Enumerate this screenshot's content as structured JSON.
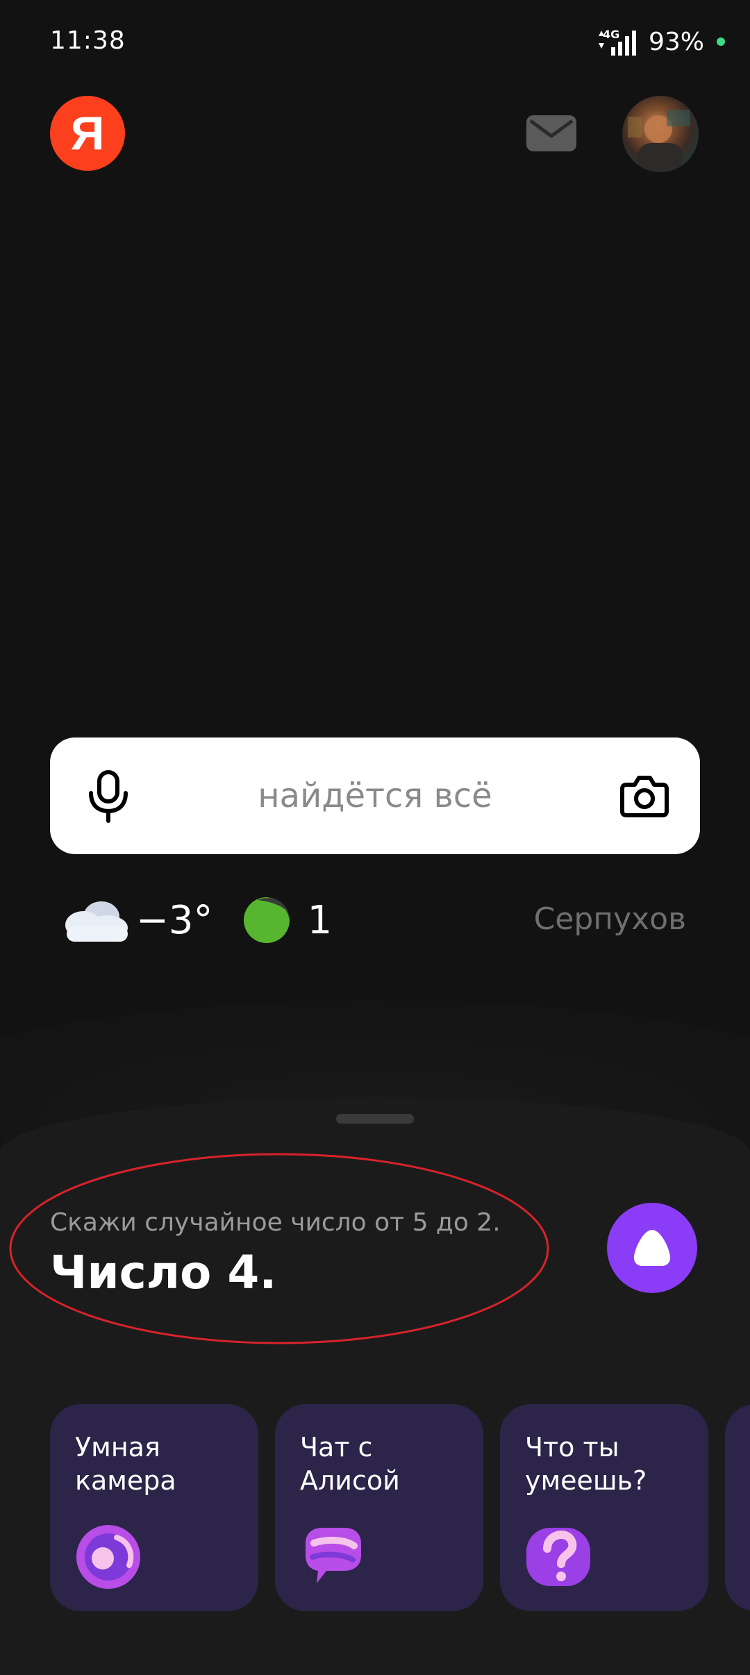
{
  "status_bar": {
    "time": "11:38",
    "network": "4G",
    "battery": "93%",
    "dot_color": "#3ddc84"
  },
  "header": {
    "logo_text": "Я",
    "logo_color": "#fc3f1d",
    "mail_icon": "mail-icon",
    "avatar": "user-avatar"
  },
  "search": {
    "placeholder": "найдётся всё",
    "left_icon": "microphone-icon",
    "right_icon": "camera-icon"
  },
  "widgets": {
    "weather_icon": "cloud-icon",
    "temperature": "−3°",
    "traffic_icon": "traffic-icon",
    "traffic_score": "1",
    "traffic_color": "#58b52f",
    "city": "Серпухов"
  },
  "alice": {
    "query": "Скажи случайное число от 5 до 2.",
    "answer": "Число 4.",
    "button_icon": "alice-icon",
    "button_color": "#8b3cf7",
    "annotation_color": "#d8232a"
  },
  "cards": [
    {
      "title": "Умная\nкамера",
      "icon": "smart-camera-icon"
    },
    {
      "title": "Чат с\nАлисой",
      "icon": "chat-bubble-icon"
    },
    {
      "title": "Что ты\nумеешь?",
      "icon": "question-icon"
    }
  ],
  "colors": {
    "background": "#121212",
    "sheet": "#1b1b1b",
    "card": "#2c2549",
    "accent": "#8b3cf7"
  }
}
